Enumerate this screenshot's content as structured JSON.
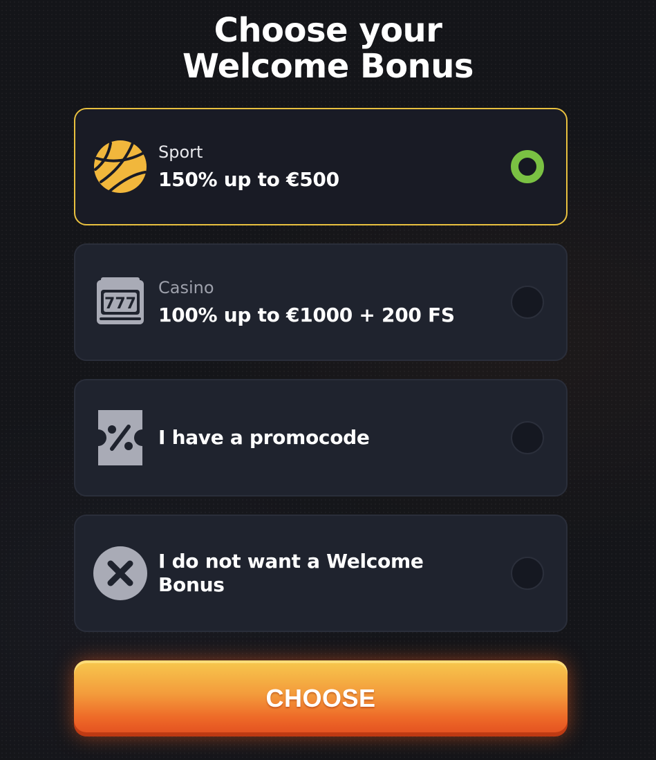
{
  "header": {
    "title_line1": "Choose your",
    "title_line2": "Welcome Bonus"
  },
  "options": [
    {
      "sub": "Sport",
      "main": "150% up to €500",
      "icon": "basketball-icon",
      "selected": true
    },
    {
      "sub": "Casino",
      "main": "100% up to €1000 + 200 FS",
      "icon": "slot-machine-icon",
      "selected": false
    },
    {
      "sub": "",
      "main": "I have a promocode",
      "icon": "promo-ticket-icon",
      "selected": false
    },
    {
      "sub": "",
      "main": "I do not want a Welcome Bonus",
      "icon": "close-circle-icon",
      "selected": false
    }
  ],
  "button": {
    "label": "CHOOSE"
  },
  "colors": {
    "accent_border": "#e9c13f",
    "radio_selected": "#7ac143",
    "sport_icon": "#f1b73c",
    "muted_icon": "#a9abb6"
  }
}
